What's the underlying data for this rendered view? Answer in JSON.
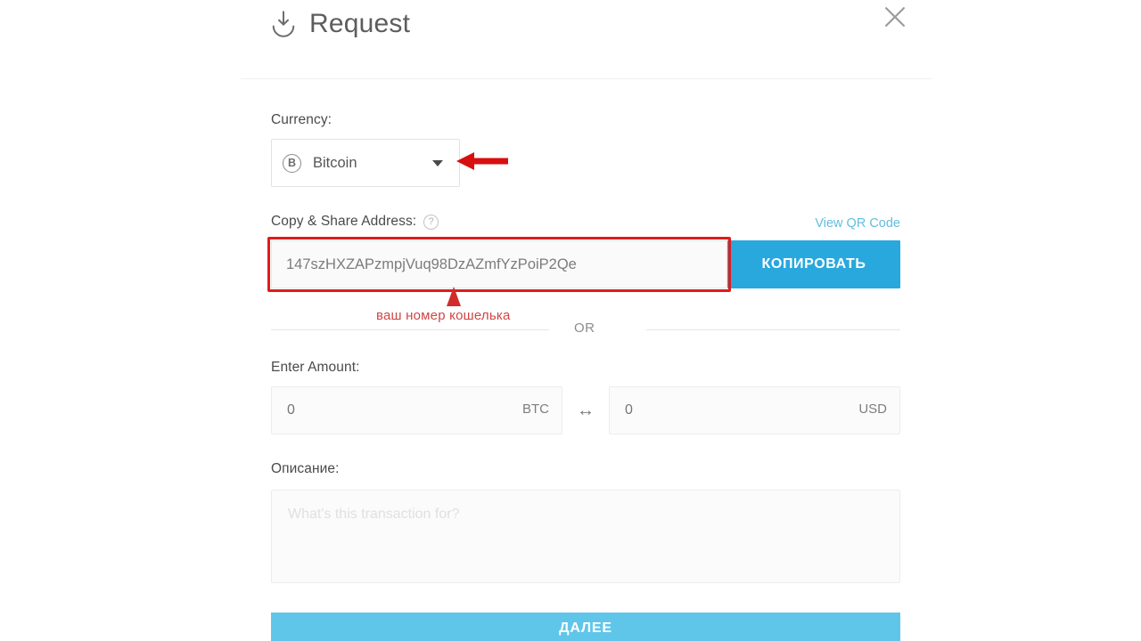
{
  "header": {
    "title": "Request",
    "download_icon": "download-icon",
    "close_icon": "close-icon"
  },
  "currency": {
    "label": "Currency:",
    "selected": "Bitcoin",
    "coin_symbol": "B",
    "caret_icon": "chevron-down-icon"
  },
  "address": {
    "label": "Copy & Share Address:",
    "help_icon": "?",
    "qr_link": "View QR Code",
    "value": "147szHXZAPzmpjVuq98DzAZmfYzPoiP2Qe",
    "copy_button": "КОПИРОВАТЬ"
  },
  "annotation": {
    "text": "ваш номер кошелька",
    "color": "#cf4646",
    "arrow_icon": "up-arrow-icon",
    "pointer_icon": "left-arrow-icon"
  },
  "divider": {
    "or_label": "OR"
  },
  "amount": {
    "label": "Enter Amount:",
    "crypto_placeholder": "0",
    "crypto_unit": "BTC",
    "swap_icon": "↔",
    "fiat_placeholder": "0",
    "fiat_unit": "USD"
  },
  "description": {
    "label": "Описание:",
    "placeholder": "What's this transaction for?",
    "value": ""
  },
  "submit": {
    "label": "ДАЛЕЕ"
  },
  "colors": {
    "accent_blue": "#29a8dd",
    "submit_blue": "#5fc6ea",
    "link_blue": "#62bde0",
    "highlight_red": "#e01b1b",
    "annotation_red": "#cf4646"
  }
}
